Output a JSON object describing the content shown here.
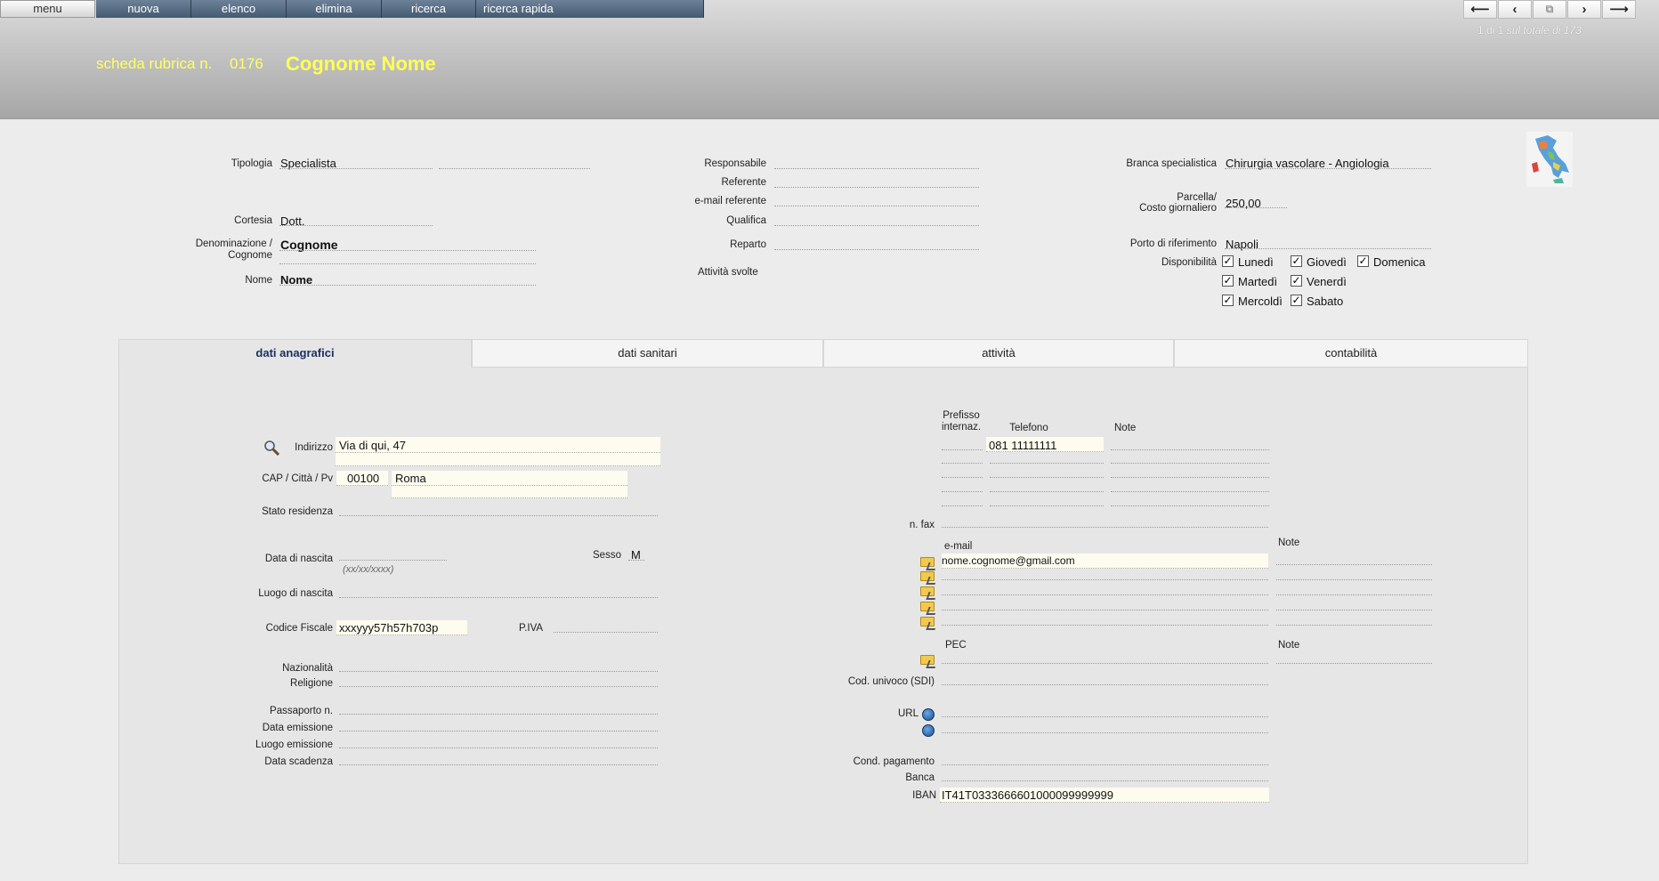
{
  "toolbar": {
    "menu": "menu",
    "nuova": "nuova",
    "elenco": "elenco",
    "elimina": "elimina",
    "ricerca": "ricerca",
    "ricerca_rapida": "ricerca rapida"
  },
  "record": {
    "pos": "1 di 1",
    "total_label": "sul totale di 173"
  },
  "header": {
    "scheda": "scheda rubrica n.",
    "numero": "0176",
    "name": "Cognome Nome"
  },
  "left": {
    "tipologia_label": "Tipologia",
    "tipologia": "Specialista",
    "cortesia_label": "Cortesia",
    "cortesia": "Dott.",
    "denominazione_label": "Denominazione /",
    "cognome_label": "Cognome",
    "cognome": "Cognome",
    "nome_label": "Nome",
    "nome": "Nome"
  },
  "middle": {
    "responsabile": "Responsabile",
    "referente": "Referente",
    "email_referente": "e-mail referente",
    "qualifica": "Qualifica",
    "reparto": "Reparto",
    "attivita": "Attività svolte"
  },
  "right": {
    "branca_label": "Branca specialistica",
    "branca": "Chirurgia vascolare - Angiologia",
    "parcella_label": "Parcella/",
    "costo_label": "Costo giornaliero",
    "parcella": "250,00",
    "porto_label": "Porto di riferimento",
    "porto": "Napoli",
    "disp_label": "Disponibilità",
    "days": [
      "Lunedì",
      "Giovedì",
      "Domenica",
      "Martedì",
      "Venerdì",
      "Mercoldì",
      "Sabato"
    ]
  },
  "tabs": [
    "dati anagrafici",
    "dati sanitari",
    "attività",
    "contabilità"
  ],
  "anagrafici": {
    "indirizzo_label": "Indirizzo",
    "indirizzo": "Via di qui, 47",
    "cap_label": "CAP  / Città  / Pv",
    "cap": "00100",
    "citta": "Roma",
    "stato_label": "Stato residenza",
    "nascita_label": "Data di nascita",
    "nascita_hint": "(xx/xx/xxxx)",
    "sesso_label": "Sesso",
    "sesso": "M",
    "luogo_label": "Luogo di nascita",
    "cf_label": "Codice Fiscale",
    "cf": "xxxyyy57h57h703p",
    "piva_label": "P.IVA",
    "nazionalita_label": "Nazionalità",
    "religione_label": "Religione",
    "passaporto_label": "Passaporto n.",
    "emissione_label": "Data emissione",
    "luogo_em_label": "Luogo emissione",
    "scadenza_label": "Data scadenza"
  },
  "contatti": {
    "prefisso_label": "Prefisso",
    "internaz_label": "internaz.",
    "telefono_label": "Telefono",
    "note_label": "Note",
    "telefono": "081 11111111",
    "fax_label": "n. fax",
    "email_label": "e-mail",
    "email": "nome.cognome@gmail.com",
    "note2_label": "Note",
    "pec_label": "PEC",
    "note3_label": "Note",
    "sdi_label": "Cod. univoco (SDI)",
    "url_label": "URL",
    "cond_label": "Cond. pagamento",
    "banca_label": "Banca",
    "iban_label": "IBAN",
    "iban": "IT41T0333666601000099999999"
  }
}
